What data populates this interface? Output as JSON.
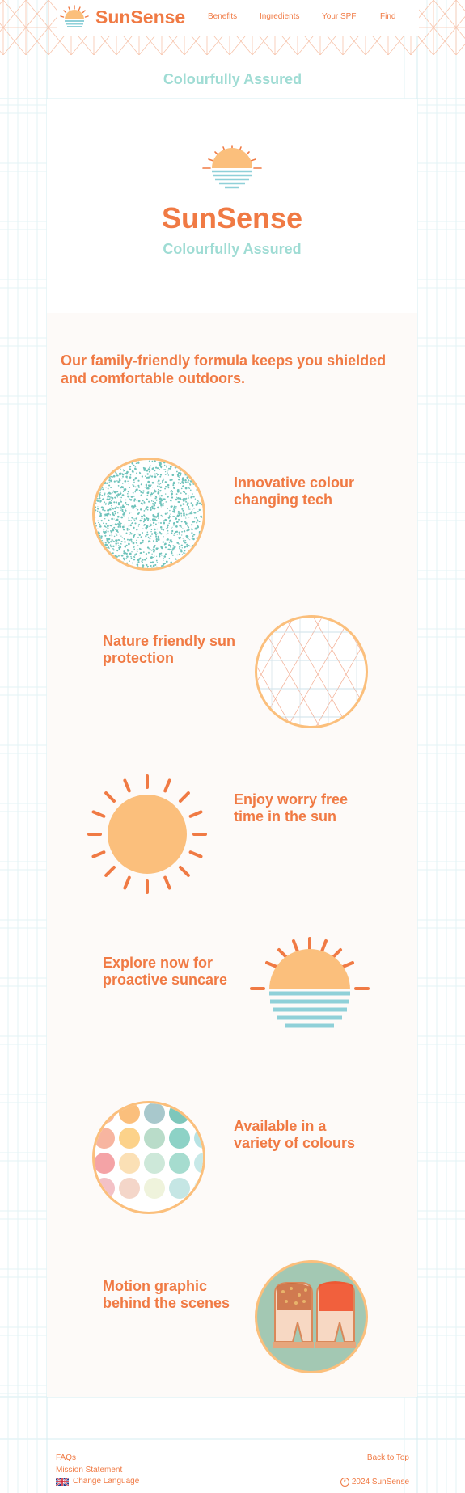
{
  "header": {
    "brand": "SunSense",
    "nav": [
      "Benefits",
      "Ingredients",
      "Your SPF",
      "Find"
    ]
  },
  "tagline": "Colourfully Assured",
  "hero": {
    "brand": "SunSense",
    "tagline": "Colourfully Assured"
  },
  "intro": "Our family-friendly formula keeps you shielded and comfortable outdoors.",
  "features": [
    {
      "text": "Innovative colour changing tech",
      "visual": "teal-noise-circle"
    },
    {
      "text": "Nature friendly sun protection",
      "visual": "geometric-line-circle"
    },
    {
      "text": "Enjoy worry free time in the sun",
      "visual": "sun-icon"
    },
    {
      "text": "Explore now for proactive suncare",
      "visual": "sunset-icon"
    },
    {
      "text": "Available in a variety of colours",
      "visual": "colour-dots-circle"
    },
    {
      "text": "Motion graphic behind the scenes",
      "visual": "toast-photo-circle"
    }
  ],
  "footer": {
    "faqs": "FAQs",
    "mission": "Mission Statement",
    "language": "Change Language",
    "back_to_top": "Back to Top",
    "copyright": "2024 SunSense"
  },
  "colors": {
    "brand_orange": "#f07a44",
    "sun_yellow": "#fbbf7c",
    "mint": "#9fdcd4",
    "teal_lines": "#8fd0d8",
    "grid_blue": "#cde9ee"
  }
}
